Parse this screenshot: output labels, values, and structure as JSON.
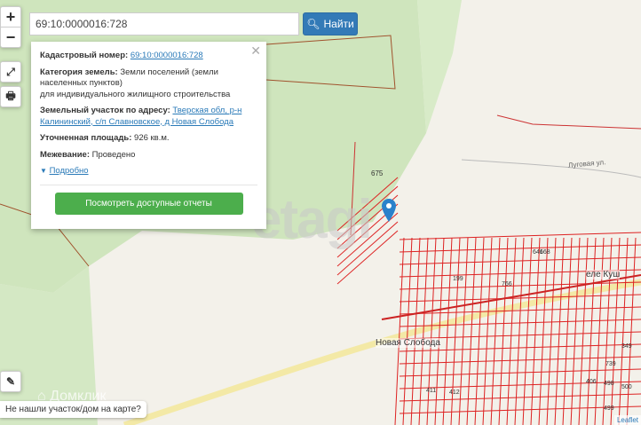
{
  "search": {
    "value": "69:10:0000016:728",
    "button_label": "Найти"
  },
  "controls": {
    "zoom_in": "+",
    "zoom_out": "−"
  },
  "popup": {
    "cadastral_label": "Кадастровый номер:",
    "cadastral_value": "69:10:0000016:728",
    "category_label": "Категория земель:",
    "category_value": "Земли поселений (земли населенных пунктов)",
    "category_use": "для индивидуального жилищного строительства",
    "address_label": "Земельный участок по адресу:",
    "address_value": "Тверская обл, р-н Калининский, с/п Славновское, д Новая Слобода",
    "area_label": "Уточненная площадь:",
    "area_value": "926 кв.м.",
    "survey_label": "Межевание:",
    "survey_value": "Проведено",
    "details_link": "Подробно",
    "reports_button": "Посмотреть доступные отчеты"
  },
  "map_labels": {
    "village": "Новая Слобода",
    "street": "Луговая ул.",
    "parcel_675": "675",
    "village2": "еле Куш",
    "parcels": [
      "199",
      "766",
      "641",
      "411",
      "412",
      "406",
      "498",
      "500",
      "499",
      "739",
      "349",
      "668"
    ]
  },
  "watermark": "etagi",
  "watermark2": "Домклик",
  "not_found": "Не нашли участок/дом на карте?",
  "attribution": "Leaflet"
}
